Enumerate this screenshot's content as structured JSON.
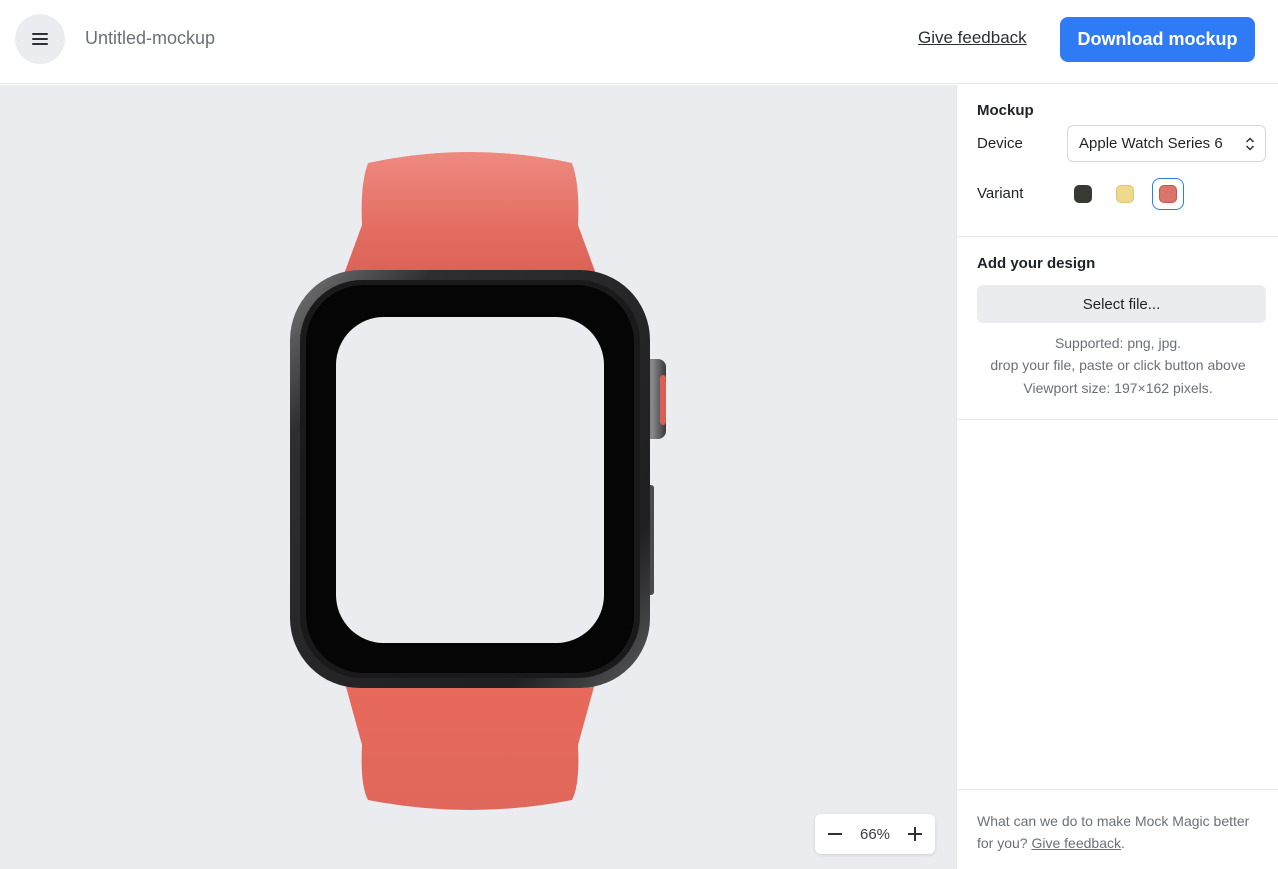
{
  "header": {
    "document_title": "Untitled-mockup",
    "feedback_label": "Give feedback",
    "download_label": "Download mockup",
    "menu_icon": "hamburger-menu-icon",
    "accent_color": "#2f7bf6"
  },
  "canvas": {
    "zoom_level": "66%",
    "zoom_out_icon": "minus-icon",
    "zoom_in_icon": "plus-icon",
    "background_color": "#ebecf0"
  },
  "panel": {
    "mockup_section_title": "Mockup",
    "device_label": "Device",
    "device_value": "Apple Watch Series 6",
    "variant_label": "Variant",
    "variants": [
      {
        "color": "#363a33",
        "selected": false
      },
      {
        "color": "#efd98d",
        "selected": false
      },
      {
        "color": "#d9756a",
        "selected": true
      }
    ],
    "design_section_title": "Add your design",
    "select_file_label": "Select file...",
    "supported_text": "Supported: png, jpg.",
    "drop_text": "drop your file, paste or click button above",
    "viewport_text": "Viewport size: 197×162 pixels.",
    "footer_text": "What can we do to make Mock Magic better for you?",
    "footer_link": "Give feedback",
    "footer_period": "."
  }
}
